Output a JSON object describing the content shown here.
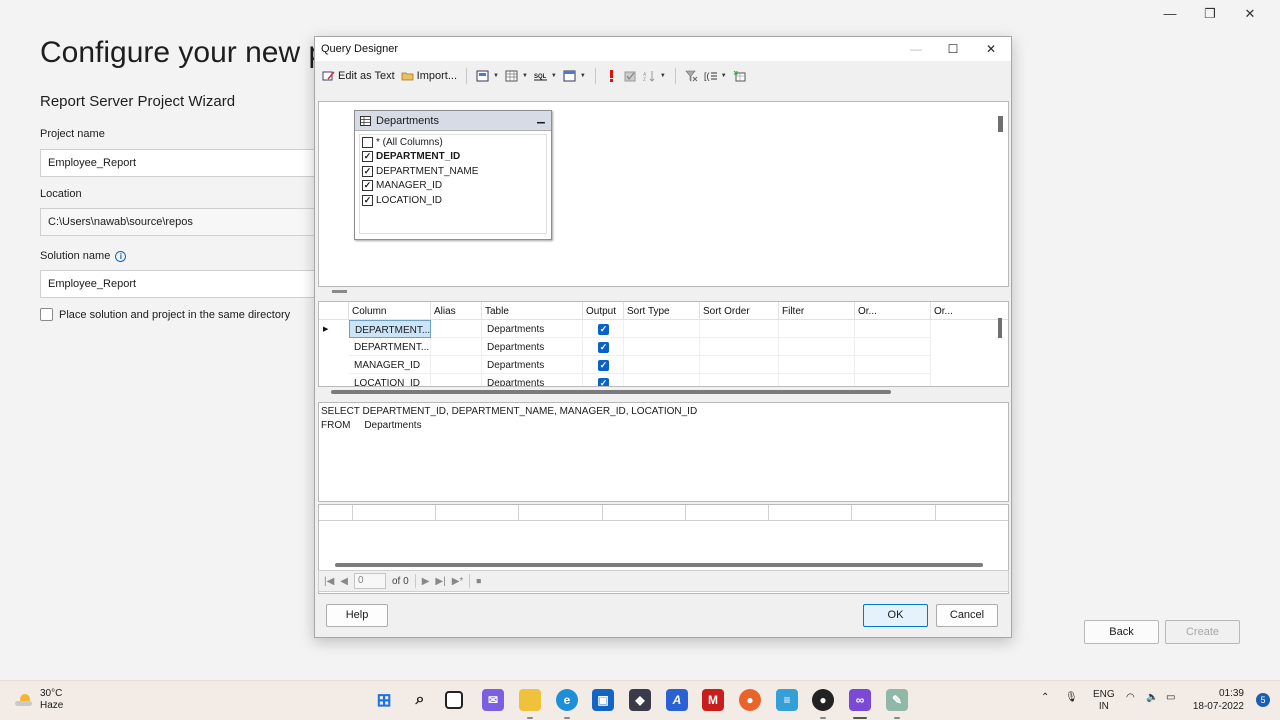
{
  "wizard": {
    "title": "Configure your new pr",
    "subtitle": "Report Server Project Wizard",
    "project_name_label": "Project name",
    "project_name_value": "Employee_Report",
    "location_label": "Location",
    "location_value": "C:\\Users\\nawab\\source\\repos",
    "solution_name_label": "Solution name",
    "solution_name_value": "Employee_Report",
    "same_dir_label": "Place solution and project in the same directory",
    "back_label": "Back",
    "create_label": "Create"
  },
  "dialog": {
    "title": "Query Designer",
    "toolbar": {
      "edit_as_text": "Edit as Text",
      "import": "Import..."
    },
    "table": {
      "name": "Departments",
      "columns": [
        {
          "label": "* (All Columns)",
          "checked": false
        },
        {
          "label": "DEPARTMENT_ID",
          "checked": true
        },
        {
          "label": "DEPARTMENT_NAME",
          "checked": true
        },
        {
          "label": "MANAGER_ID",
          "checked": true
        },
        {
          "label": "LOCATION_ID",
          "checked": true
        }
      ]
    },
    "grid": {
      "headers": [
        "Column",
        "Alias",
        "Table",
        "Output",
        "Sort Type",
        "Sort Order",
        "Filter",
        "Or...",
        "Or..."
      ],
      "rows": [
        {
          "column": "DEPARTMENT...",
          "table": "Departments"
        },
        {
          "column": "DEPARTMENT...",
          "table": "Departments"
        },
        {
          "column": "MANAGER_ID",
          "table": "Departments"
        },
        {
          "column": "LOCATION_ID",
          "table": "Departments"
        }
      ]
    },
    "sql": {
      "line1": "SELECT DEPARTMENT_ID, DEPARTMENT_NAME, MANAGER_ID, LOCATION_ID",
      "line2": "FROM     Departments"
    },
    "nav": {
      "record": "0",
      "of": "of 0"
    },
    "help_label": "Help",
    "ok_label": "OK",
    "cancel_label": "Cancel"
  },
  "taskbar": {
    "temperature": "30°C",
    "condition": "Haze",
    "lang1": "ENG",
    "lang2": "IN",
    "time": "01:39",
    "date": "18-07-2022",
    "notifications": "5"
  }
}
